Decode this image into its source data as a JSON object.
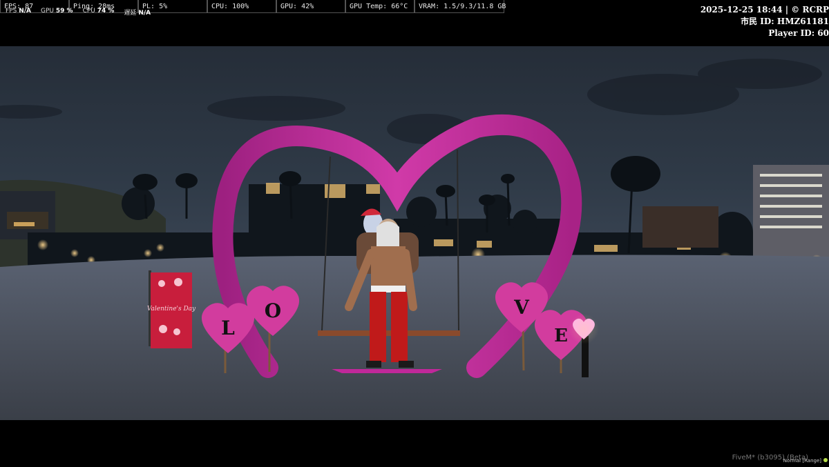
{
  "perf": {
    "fps": "FPS: 87",
    "ping": "Ping: 28ms",
    "pl": "PL: 5%",
    "cpu": "CPU: 100%",
    "gpu": "GPU: 42%",
    "gpu_temp": "GPU Temp: 66°C",
    "vram": "VRAM: 1.5/9.3/11.8 GB"
  },
  "perf_overlay": {
    "fps_label": "FPS",
    "fps_value": "N/A",
    "gpu_label": "GPU",
    "gpu_value": "59 %",
    "cpu_label": "CPU",
    "cpu_value": "74 %",
    "latency_label": "遅延",
    "latency_value": "N/A"
  },
  "server_info": {
    "datetime": "2025-12-25 18:44 | © RCRP",
    "citizen_id": "市民 ID: HMZ61181",
    "player_id": "Player ID: 60"
  },
  "scene": {
    "letters": [
      "L",
      "O",
      "V",
      "E"
    ],
    "banner_text": "Valentine's Day"
  },
  "footer": {
    "watermark": "FiveM* (b3095) (Beta)",
    "talk_status": "Normal [Range]"
  },
  "colors": {
    "heart_arch": "#c0289a",
    "sign_heart": "#d23c9e",
    "banner": "#c81e3c",
    "night_sky": "#1c2633"
  }
}
